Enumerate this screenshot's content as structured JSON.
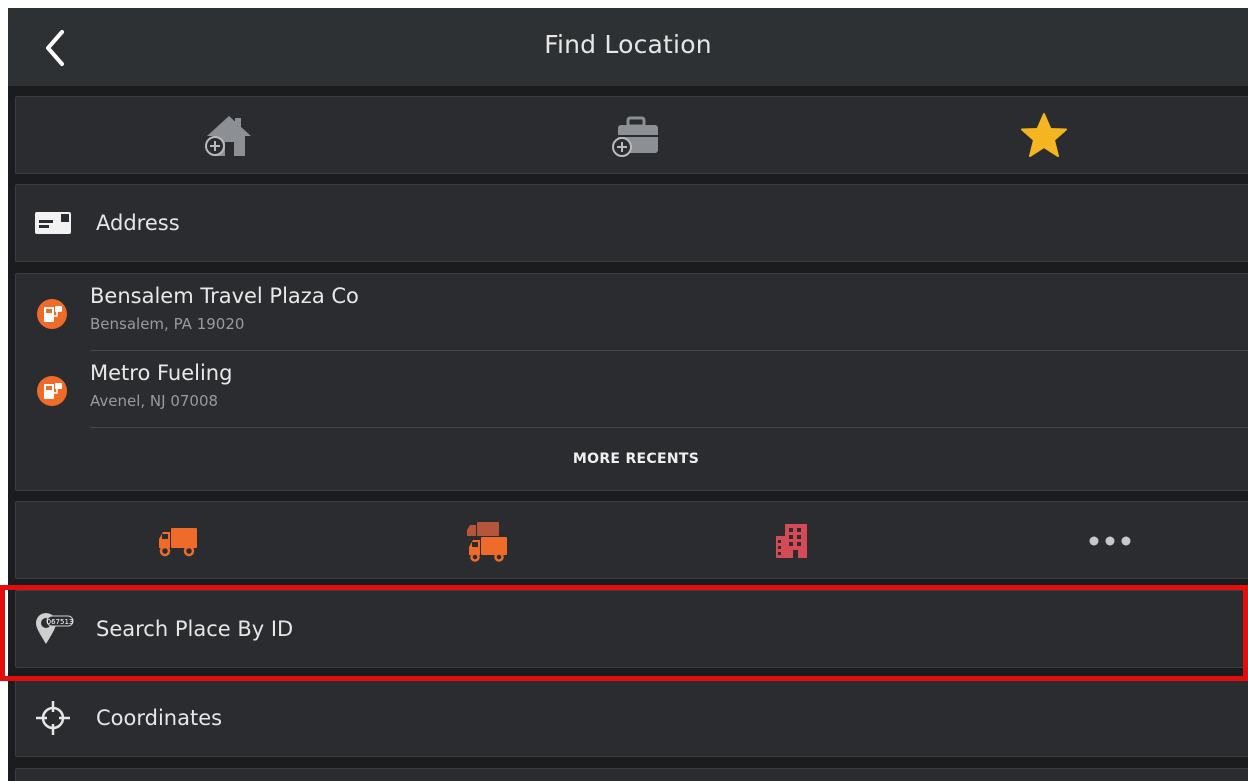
{
  "header": {
    "title": "Find Location",
    "back_icon": "chevron-left-icon"
  },
  "quick_actions": [
    {
      "name": "add-home",
      "icon": "home-plus-icon"
    },
    {
      "name": "add-work",
      "icon": "briefcase-plus-icon"
    },
    {
      "name": "favorites",
      "icon": "star-icon",
      "color": "#f4b521"
    }
  ],
  "address": {
    "label": "Address",
    "icon": "envelope-icon"
  },
  "recents": {
    "items": [
      {
        "name": "Bensalem Travel Plaza Co",
        "subtitle": "Bensalem, PA 19020",
        "icon": "fuel-station-icon"
      },
      {
        "name": "Metro Fueling",
        "subtitle": "Avenel, NJ 07008",
        "icon": "fuel-station-icon"
      }
    ],
    "more_label": "MORE RECENTS"
  },
  "categories": [
    {
      "name": "truck-stops",
      "icon": "truck-icon"
    },
    {
      "name": "truck-services",
      "icon": "trucks-icon"
    },
    {
      "name": "hotels",
      "icon": "building-icon"
    },
    {
      "name": "more",
      "icon": "more-dots-icon"
    }
  ],
  "search_place_by_id": {
    "label": "Search Place By ID",
    "icon": "place-id-icon",
    "badge": "067513"
  },
  "coordinates": {
    "label": "Coordinates",
    "icon": "crosshair-icon"
  },
  "colors": {
    "accent_orange": "#ee6b2a",
    "star_yellow": "#f4b521",
    "hotel_red": "#d54a57",
    "highlight_red": "#e20d0d",
    "background": "#1b1c1e",
    "card": "#2a2c2f"
  }
}
